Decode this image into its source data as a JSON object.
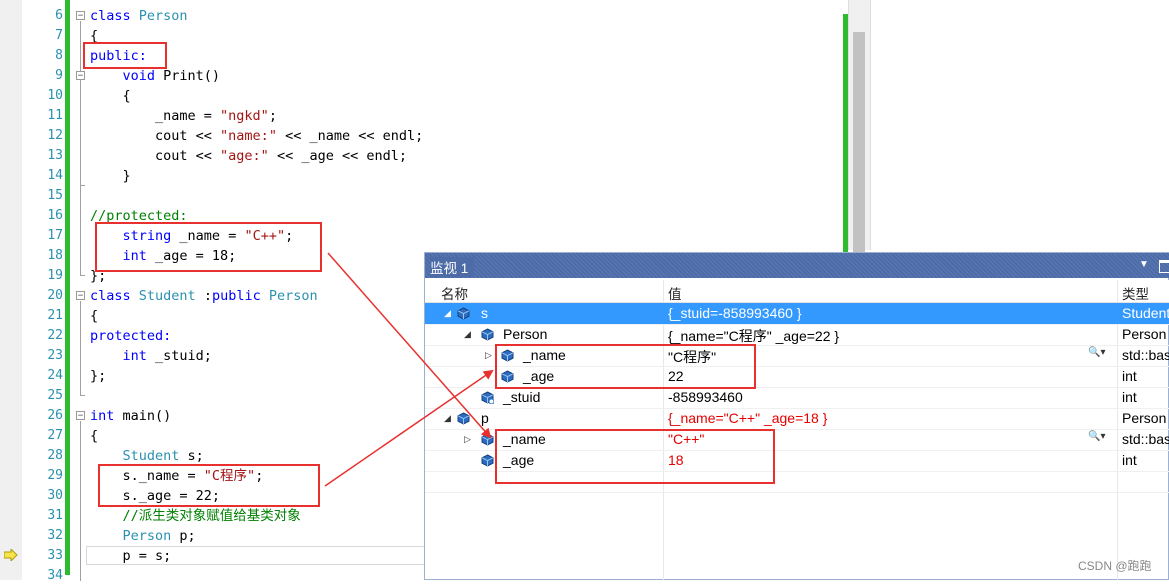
{
  "editor": {
    "lines": [
      {
        "n": "6",
        "text": "class Person"
      },
      {
        "n": "7",
        "text": "{"
      },
      {
        "n": "8",
        "text": "public:"
      },
      {
        "n": "9",
        "text": "    void Print()"
      },
      {
        "n": "10",
        "text": "    {"
      },
      {
        "n": "11",
        "text": "        _name = \"ngkd\";"
      },
      {
        "n": "12",
        "text": "        cout << \"name:\" << _name << endl;"
      },
      {
        "n": "13",
        "text": "        cout << \"age:\" << _age << endl;"
      },
      {
        "n": "14",
        "text": "    }"
      },
      {
        "n": "15",
        "text": ""
      },
      {
        "n": "16",
        "text": "//protected:"
      },
      {
        "n": "17",
        "text": "    string _name = \"C++\";"
      },
      {
        "n": "18",
        "text": "    int _age = 18;"
      },
      {
        "n": "19",
        "text": "};"
      },
      {
        "n": "20",
        "text": "class Student :public Person"
      },
      {
        "n": "21",
        "text": "{"
      },
      {
        "n": "22",
        "text": "protected:"
      },
      {
        "n": "23",
        "text": "    int _stuid;"
      },
      {
        "n": "24",
        "text": "};"
      },
      {
        "n": "25",
        "text": ""
      },
      {
        "n": "26",
        "text": "int main()"
      },
      {
        "n": "27",
        "text": "{"
      },
      {
        "n": "28",
        "text": "    Student s;"
      },
      {
        "n": "29",
        "text": "    s._name = \"C程序\";"
      },
      {
        "n": "30",
        "text": "    s._age = 22;"
      },
      {
        "n": "31",
        "text": "    //派生类对象赋值给基类对象"
      },
      {
        "n": "32",
        "text": "    Person p;"
      },
      {
        "n": "33",
        "text": "    p = s;"
      },
      {
        "n": "34",
        "text": ""
      }
    ]
  },
  "watch": {
    "title": "监视 1",
    "headers": {
      "name": "名称",
      "value": "值",
      "type": "类型"
    },
    "rows": [
      {
        "name": "s",
        "value": "{_stuid=-858993460 }",
        "type": "Student",
        "expander": "◢",
        "selected": true,
        "changed": false,
        "icon": "object-icon"
      },
      {
        "name": "Person",
        "value": "{_name=\"C程序\" _age=22 }",
        "type": "Person",
        "expander": "◢",
        "selected": false,
        "changed": false,
        "icon": "object-icon"
      },
      {
        "name": "_name",
        "value": "\"C程序\"",
        "type": "std::basic_string",
        "expander": "▷",
        "selected": false,
        "changed": false,
        "icon": "object-icon",
        "search": true
      },
      {
        "name": "_age",
        "value": "22",
        "type": "int",
        "expander": "",
        "selected": false,
        "changed": false,
        "icon": "object-icon"
      },
      {
        "name": "_stuid",
        "value": "-858993460",
        "type": "int",
        "expander": "",
        "selected": false,
        "changed": false,
        "icon": "protected-object-icon"
      },
      {
        "name": "p",
        "value": "{_name=\"C++\" _age=18 }",
        "type": "Person",
        "expander": "◢",
        "selected": false,
        "changed": true,
        "icon": "object-icon"
      },
      {
        "name": "_name",
        "value": "\"C++\"",
        "type": "std::basic_string",
        "expander": "▷",
        "selected": false,
        "changed": true,
        "icon": "object-icon",
        "search": true
      },
      {
        "name": "_age",
        "value": "18",
        "type": "int",
        "expander": "",
        "selected": false,
        "changed": true,
        "icon": "object-icon"
      }
    ]
  },
  "credit": "CSDN @跑跑",
  "colors": {
    "highlight_box": "#e8302e",
    "selection": "#3399ff",
    "watch_title": "#4d6ba6",
    "green_bar": "#2fbb2f"
  }
}
